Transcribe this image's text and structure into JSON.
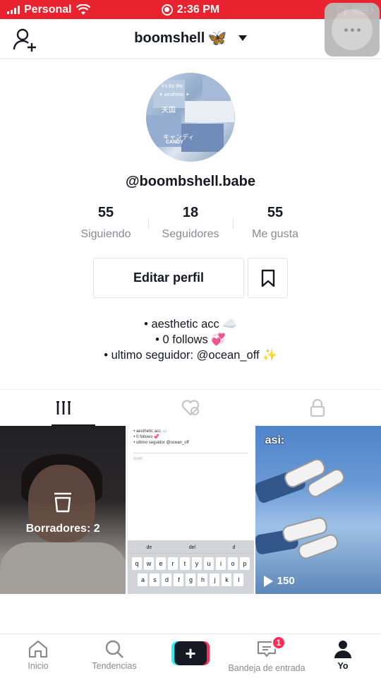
{
  "status_bar": {
    "carrier": "Personal",
    "time": "2:36 PM",
    "battery_level": 0.9
  },
  "header": {
    "username": "boomshell",
    "username_emoji": "🦋"
  },
  "profile": {
    "handle": "@boombshell.babe",
    "stats": [
      {
        "value": "55",
        "label": "Siguiendo"
      },
      {
        "value": "18",
        "label": "Seguidores"
      },
      {
        "value": "55",
        "label": "Me gusta"
      }
    ],
    "edit_button": "Editar perfil",
    "bio": [
      "• aesthetic acc ☁️",
      "• 0 follows 💞",
      "• ultimo seguidor: @ocean_off ✨"
    ]
  },
  "avatar_text": {
    "line1": "it's for the",
    "line2": "✦ aesthetic ✦",
    "line3": "天国",
    "line4": "キャンディ",
    "line5": "CANDY"
  },
  "grid": {
    "drafts_label": "Borradores: 2",
    "note_lines": [
      "• aesthetic acc ☁️",
      "• 0 follows 💞",
      "• ultimo seguidor @ocean_off"
    ],
    "note_count": "62/80",
    "keyboard_suggestions": [
      "de",
      "del",
      "d"
    ],
    "keyboard_row1": [
      "q",
      "w",
      "e",
      "r",
      "t",
      "y",
      "u",
      "i",
      "o",
      "p"
    ],
    "keyboard_row2": [
      "a",
      "s",
      "d",
      "f",
      "g",
      "h",
      "j",
      "k",
      "l"
    ],
    "video3_caption": "asi:",
    "video3_views": "150"
  },
  "bottom_nav": {
    "home": "Inicio",
    "discover": "Tendencias",
    "inbox": "Bandeja de entrada",
    "inbox_badge": "1",
    "me": "Yo"
  }
}
